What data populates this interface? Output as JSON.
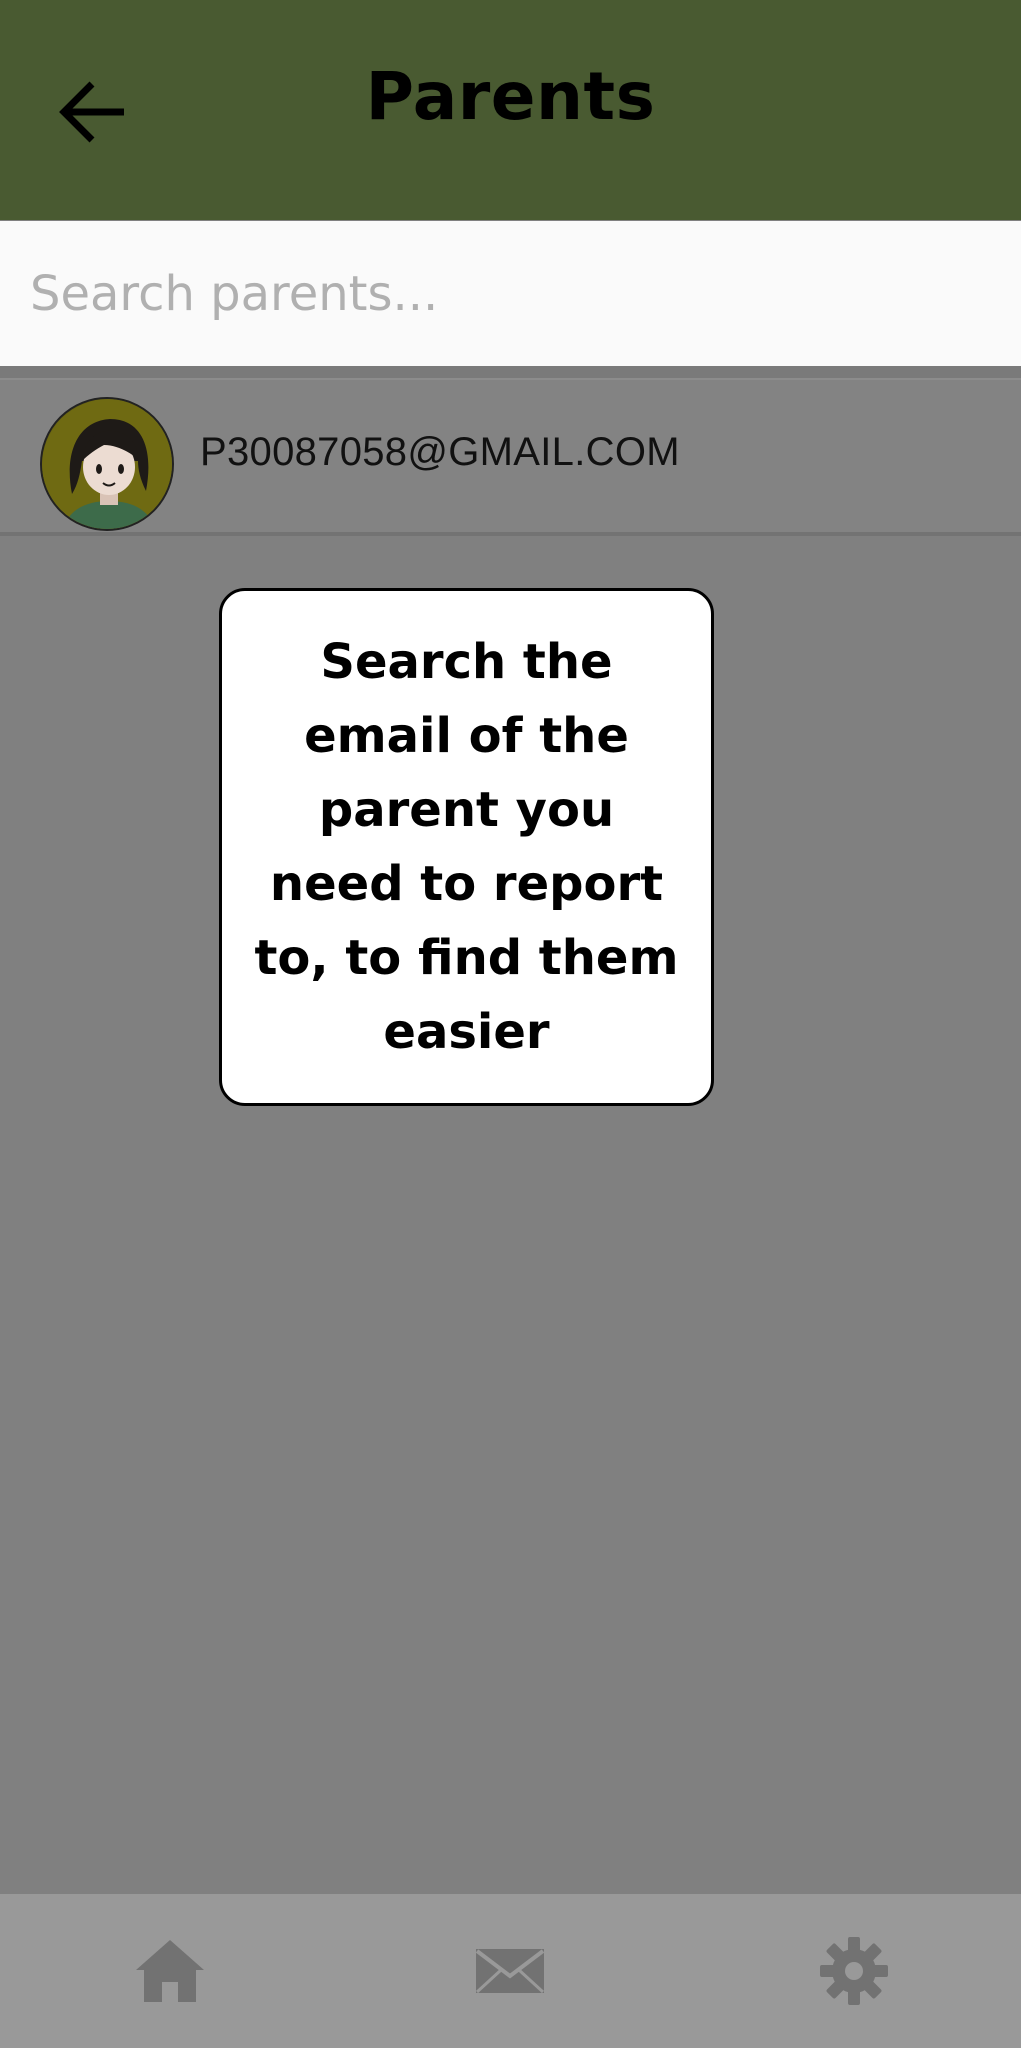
{
  "header": {
    "title": "Parents",
    "back_icon": "arrow-back-icon",
    "background_color": "#495a31"
  },
  "search": {
    "placeholder": "Search parents...",
    "value": ""
  },
  "parents": [
    {
      "email": "P30087058@GMAIL.COM",
      "avatar_icon": "avatar-girl-icon"
    }
  ],
  "tooltip": {
    "text": "Search the email of the parent you need to report to, to find them easier"
  },
  "bottom_nav": {
    "items": [
      {
        "icon": "home-icon"
      },
      {
        "icon": "mail-icon"
      },
      {
        "icon": "gear-icon"
      }
    ]
  }
}
